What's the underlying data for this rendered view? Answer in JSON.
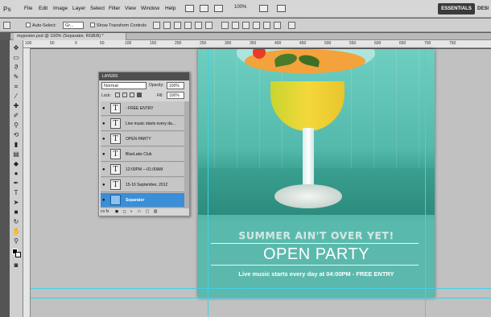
{
  "app": {
    "logo": "Ps"
  },
  "menu": [
    "File",
    "Edit",
    "Image",
    "Layer",
    "Select",
    "Filter",
    "View",
    "Window",
    "Help"
  ],
  "menubar_extras": {
    "zoom": "100%",
    "workspace_active": "ESSENTIALS",
    "workspace_other": "DESI"
  },
  "options": {
    "auto_select_label": "Auto-Select:",
    "auto_select_value": "Gr...",
    "show_transform": "Show Transform Controls"
  },
  "document": {
    "tab_title": "myposter.psd @ 100% (Separator, RGB/8) *"
  },
  "ruler_ticks": [
    "100",
    "50",
    "0",
    "50",
    "100",
    "150",
    "200",
    "250",
    "300",
    "350",
    "400",
    "450",
    "500",
    "550",
    "600",
    "650",
    "700",
    "750"
  ],
  "layers_panel": {
    "title": "LAYERS",
    "blend_mode": "Normal",
    "opacity_label": "Opacity:",
    "opacity_value": "100%",
    "lock_label": "Lock:",
    "fill_label": "Fill:",
    "fill_value": "100%",
    "layers": [
      {
        "name": "- FREE ENTRY",
        "thumb": "T",
        "selected": false
      },
      {
        "name": "Live music starts every da...",
        "thumb": "T",
        "selected": false
      },
      {
        "name": "OPEN PARTY",
        "thumb": "T",
        "selected": false
      },
      {
        "name": "BlueLake Club",
        "thumb": "T",
        "selected": false
      },
      {
        "name": "12:00PM ---01:00AM",
        "thumb": "T",
        "selected": false
      },
      {
        "name": "15-16 September, 2012",
        "thumb": "T",
        "selected": false
      },
      {
        "name": "Separator",
        "thumb": "",
        "selected": true
      }
    ],
    "footer": "co fx"
  },
  "poster": {
    "headline": "SUMMER AIN'T OVER YET!",
    "title": "OPEN PARTY",
    "subtitle": "Live music starts every day at 04:00PM  -  FREE ENTRY"
  },
  "colors": {
    "accent_selected": "#3b8ed8",
    "poster_teal": "#53b9ab"
  }
}
